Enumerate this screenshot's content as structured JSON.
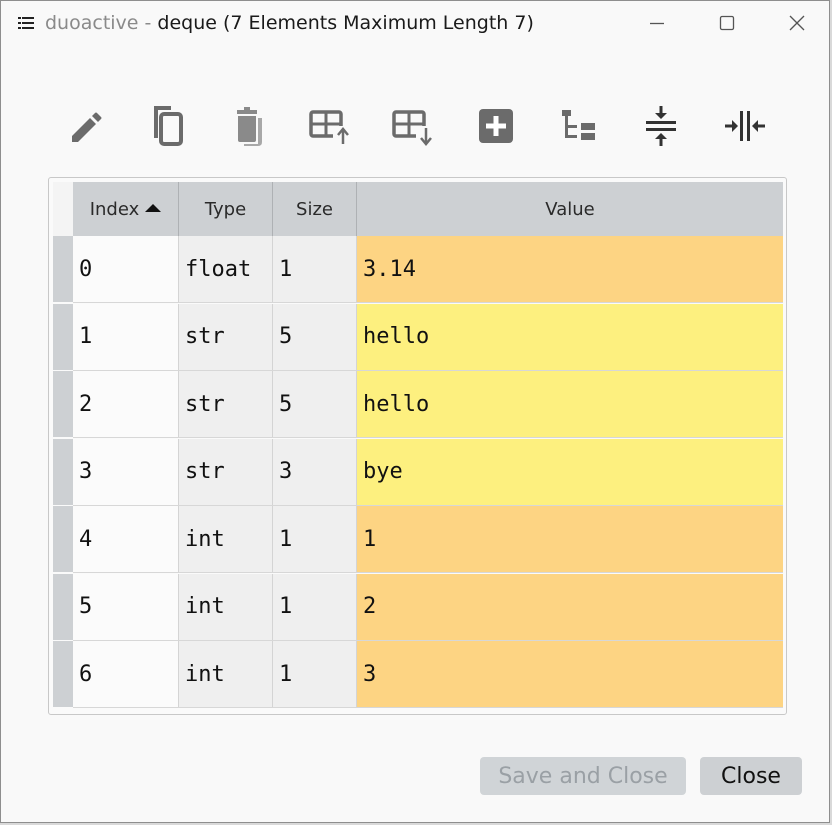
{
  "window": {
    "app_name": "duoactive",
    "separator": " - ",
    "title": "deque (7 Elements Maximum Length 7)"
  },
  "toolbar": {
    "icons": [
      "edit-icon",
      "copy-icon",
      "delete-icon",
      "insert-above-icon",
      "insert-below-icon",
      "add-icon",
      "tree-view-icon",
      "collapse-rows-icon",
      "collapse-columns-icon"
    ]
  },
  "table": {
    "columns": [
      "Index",
      "Type",
      "Size",
      "Value"
    ],
    "sort_column": "Index",
    "sort_direction": "ascending",
    "rows": [
      {
        "index": "0",
        "type": "float",
        "size": "1",
        "value": "3.14",
        "color": "#fdd483"
      },
      {
        "index": "1",
        "type": "str",
        "size": "5",
        "value": "hello",
        "color": "#fdf07f"
      },
      {
        "index": "2",
        "type": "str",
        "size": "5",
        "value": "hello",
        "color": "#fdf07f"
      },
      {
        "index": "3",
        "type": "str",
        "size": "3",
        "value": "bye",
        "color": "#fdf07f"
      },
      {
        "index": "4",
        "type": "int",
        "size": "1",
        "value": "1",
        "color": "#fdd483"
      },
      {
        "index": "5",
        "type": "int",
        "size": "1",
        "value": "2",
        "color": "#fdd483"
      },
      {
        "index": "6",
        "type": "int",
        "size": "1",
        "value": "3",
        "color": "#fdd483"
      }
    ]
  },
  "buttons": {
    "save_close": "Save and Close",
    "close": "Close"
  }
}
